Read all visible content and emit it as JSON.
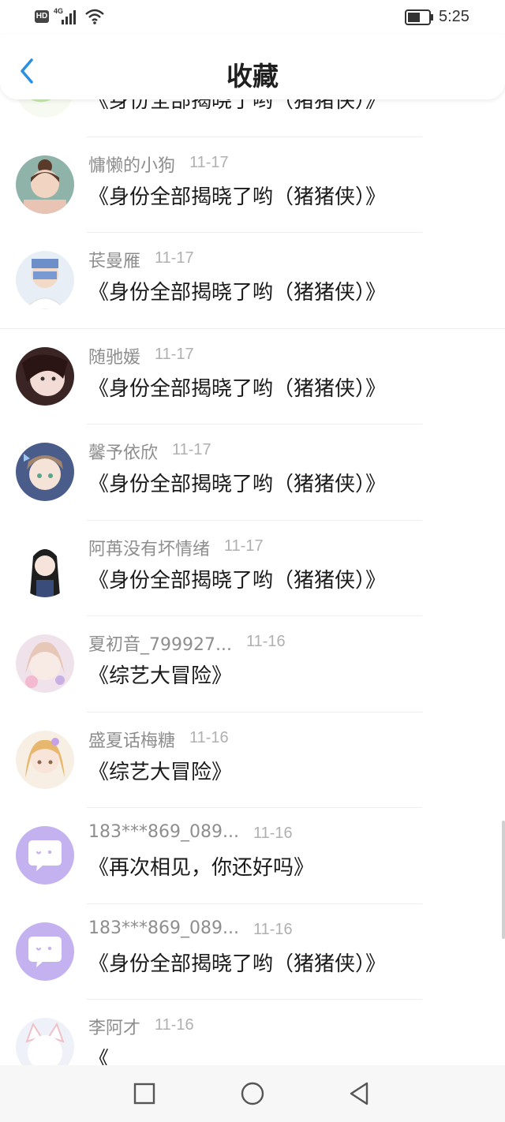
{
  "status_bar": {
    "hd": "HD",
    "network": "4G",
    "time": "5:25"
  },
  "header": {
    "title": "收藏",
    "back_icon": "chevron-left-icon"
  },
  "colors": {
    "accent": "#2a8fe0",
    "title_text": "#1f1f1f",
    "meta_text": "#8e8e8e",
    "date_text": "#b0b0b0",
    "placeholder_avatar": "#c4b2f0"
  },
  "favorites": [
    {
      "name": "",
      "date": "",
      "title": "《身份全部揭晓了哟（猪猪侠）》",
      "avatar": "leaf-avatar"
    },
    {
      "name": "慵懒的小狗",
      "date": "11-17",
      "title": "《身份全部揭晓了哟（猪猪侠）》",
      "avatar": "girl-avatar"
    },
    {
      "name": "苌曼雁",
      "date": "11-17",
      "title": "《身份全部揭晓了哟（猪猪侠）》",
      "avatar": "boy-avatar"
    },
    {
      "name": "随驰媛",
      "date": "11-17",
      "title": "《身份全部揭晓了哟（猪猪侠）》",
      "avatar": "woman-avatar"
    },
    {
      "name": "馨予依欣",
      "date": "11-17",
      "title": "《身份全部揭晓了哟（猪猪侠）》",
      "avatar": "anime-girl-avatar"
    },
    {
      "name": "阿苒没有坏情绪",
      "date": "11-17",
      "title": "《身份全部揭晓了哟（猪猪侠）》",
      "avatar": "chibi-avatar"
    },
    {
      "name": "夏初音_799927...",
      "date": "11-16",
      "title": "《综艺大冒险》",
      "avatar": "pastel-girl-avatar"
    },
    {
      "name": "盛夏话梅糖",
      "date": "11-16",
      "title": "《综艺大冒险》",
      "avatar": "princess-avatar"
    },
    {
      "name": "183***869_089...",
      "date": "11-16",
      "title": "《再次相见，你还好吗》",
      "avatar": "chat-bubble-avatar"
    },
    {
      "name": "183***869_089...",
      "date": "11-16",
      "title": "《身份全部揭晓了哟（猪猪侠）》",
      "avatar": "chat-bubble-avatar"
    },
    {
      "name": "李阿才",
      "date": "11-16",
      "title": "《",
      "avatar": "cat-ear-avatar"
    }
  ],
  "nav_bar": {
    "recent_icon": "square-icon",
    "home_icon": "circle-icon",
    "back_icon": "triangle-back-icon"
  }
}
